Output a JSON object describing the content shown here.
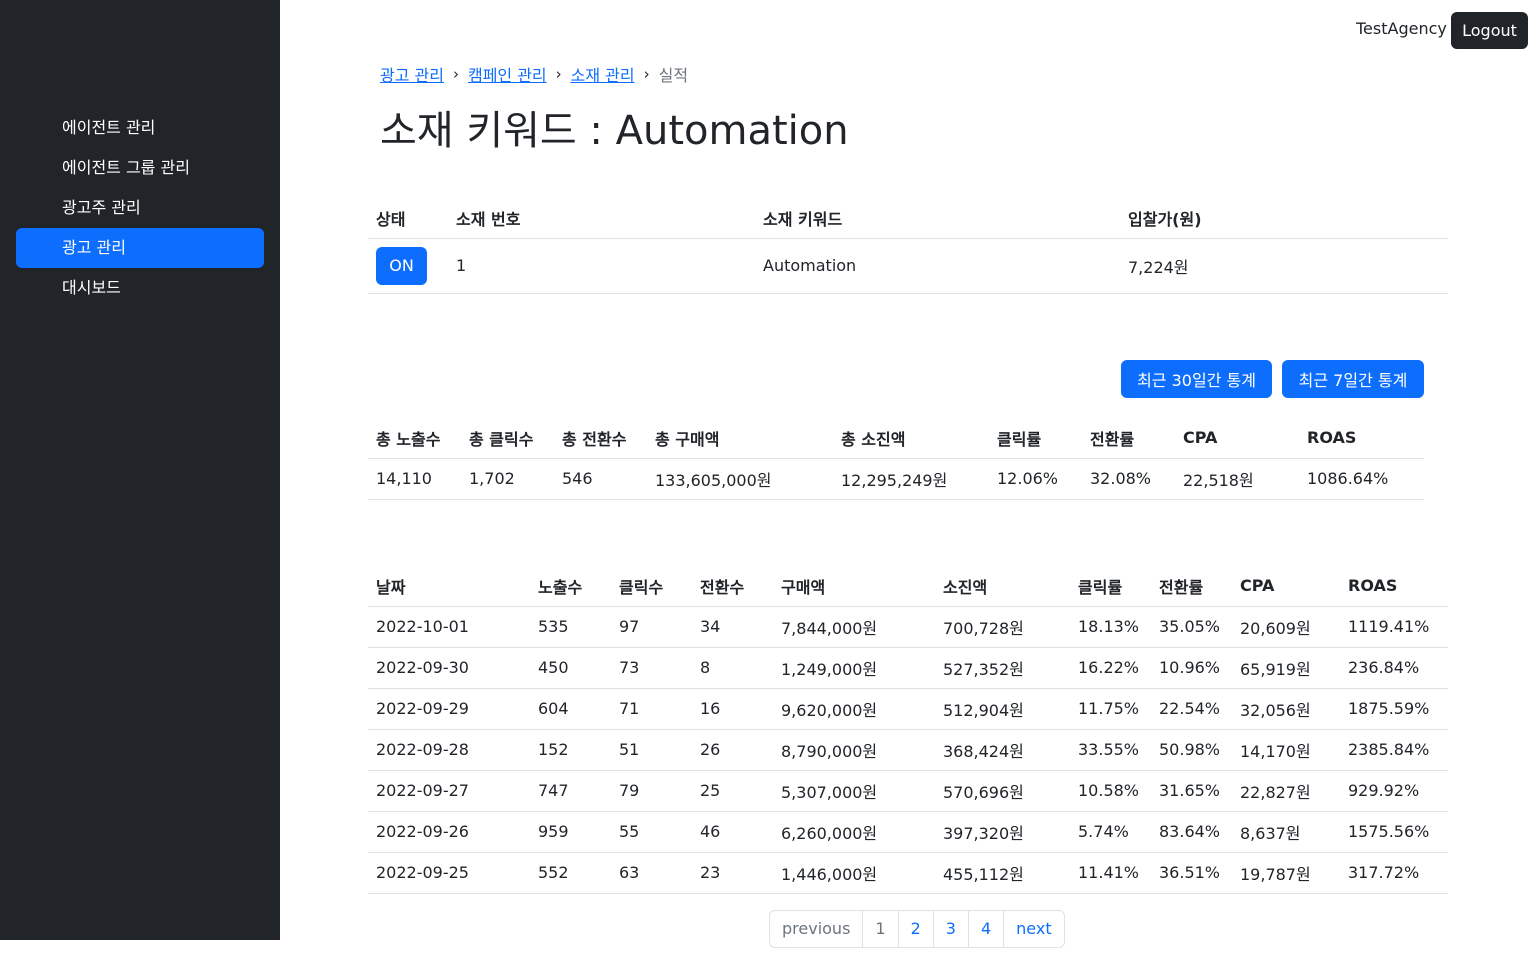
{
  "sidebar": {
    "items": [
      {
        "label": "에이전트 관리"
      },
      {
        "label": "에이전트 그룹 관리"
      },
      {
        "label": "광고주 관리"
      },
      {
        "label": "광고 관리",
        "active": true
      },
      {
        "label": "대시보드"
      }
    ]
  },
  "topbar": {
    "user": "TestAgency",
    "logout_label": "Logout"
  },
  "breadcrumb": {
    "items": [
      "광고 관리",
      "캠페인 관리",
      "소재 관리"
    ],
    "current": "실적",
    "separator": "›"
  },
  "page_title": "소재 키워드 : Automation",
  "info_table": {
    "headers": [
      "상태",
      "소재 번호",
      "소재 키워드",
      "입찰가(원)"
    ],
    "row": {
      "status": "ON",
      "number": "1",
      "keyword": "Automation",
      "bid": "7,224원"
    }
  },
  "stat_buttons": {
    "last30": "최근 30일간 통계",
    "last7": "최근 7일간 통계"
  },
  "totals_table": {
    "headers": [
      "총 노출수",
      "총 클릭수",
      "총 전환수",
      "총 구매액",
      "총 소진액",
      "클릭률",
      "전환률",
      "CPA",
      "ROAS"
    ],
    "row": [
      "14,110",
      "1,702",
      "546",
      "133,605,000원",
      "12,295,249원",
      "12.06%",
      "32.08%",
      "22,518원",
      "1086.64%"
    ]
  },
  "daily_table": {
    "headers": [
      "날짜",
      "노출수",
      "클릭수",
      "전환수",
      "구매액",
      "소진액",
      "클릭률",
      "전환률",
      "CPA",
      "ROAS"
    ],
    "rows": [
      [
        "2022-10-01",
        "535",
        "97",
        "34",
        "7,844,000원",
        "700,728원",
        "18.13%",
        "35.05%",
        "20,609원",
        "1119.41%"
      ],
      [
        "2022-09-30",
        "450",
        "73",
        "8",
        "1,249,000원",
        "527,352원",
        "16.22%",
        "10.96%",
        "65,919원",
        "236.84%"
      ],
      [
        "2022-09-29",
        "604",
        "71",
        "16",
        "9,620,000원",
        "512,904원",
        "11.75%",
        "22.54%",
        "32,056원",
        "1875.59%"
      ],
      [
        "2022-09-28",
        "152",
        "51",
        "26",
        "8,790,000원",
        "368,424원",
        "33.55%",
        "50.98%",
        "14,170원",
        "2385.84%"
      ],
      [
        "2022-09-27",
        "747",
        "79",
        "25",
        "5,307,000원",
        "570,696원",
        "10.58%",
        "31.65%",
        "22,827원",
        "929.92%"
      ],
      [
        "2022-09-26",
        "959",
        "55",
        "46",
        "6,260,000원",
        "397,320원",
        "5.74%",
        "83.64%",
        "8,637원",
        "1575.56%"
      ],
      [
        "2022-09-25",
        "552",
        "63",
        "23",
        "1,446,000원",
        "455,112원",
        "11.41%",
        "36.51%",
        "19,787원",
        "317.72%"
      ]
    ]
  },
  "pagination": {
    "previous": "previous",
    "pages": [
      "1",
      "2",
      "3",
      "4"
    ],
    "next": "next",
    "current": "1"
  },
  "colors": {
    "sidebar_bg": "#212529",
    "accent": "#0d6efd",
    "muted": "#6c757d"
  }
}
